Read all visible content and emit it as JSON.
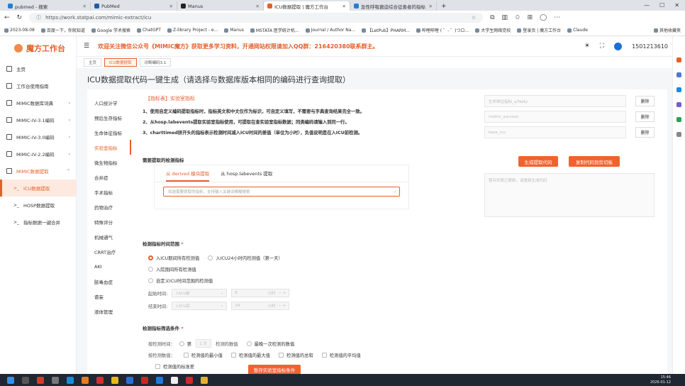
{
  "browser": {
    "tabs": [
      {
        "title": "pubmed - 搜索",
        "color": "#2b7cd3"
      },
      {
        "title": "PubMed",
        "color": "#1f5ca8"
      },
      {
        "title": "Manus",
        "color": "#222222"
      },
      {
        "title": "ICU数据提取 | 魔方工作台",
        "color": "#e4602b"
      },
      {
        "title": "急性呼吸窘迫综合征患者的指标",
        "color": "#2b7cd3"
      }
    ],
    "url": "https://work.statpai.com/mimic-extract/icu",
    "bookmarks": [
      "2023-08-08",
      "百度一下，你就知道",
      "Google 学术搜索",
      "ChatGPT",
      "Z-library Project - e...",
      "Manus",
      "MSTATA 医学统计机...",
      "Journal / Author Na...",
      "【LetPub】PHARM...",
      "哔哩哔哩 ( ゜- ゜)つロ...",
      "大学生网络党校",
      "登录页 | 魔方工作台",
      "Claude",
      "其他收藏夹"
    ]
  },
  "app": {
    "logo": "魔方工作台",
    "notice": "欢迎关注微信公众号《MIMIC魔方》获取更多学习资料，开通网站权限请加入QQ群：216420380联系群主。",
    "user": "1501213610",
    "nav": [
      {
        "label": "主页",
        "type": "item"
      },
      {
        "label": "工作台使用指南",
        "type": "item"
      },
      {
        "label": "MIMIC数据库词典",
        "type": "group"
      },
      {
        "label": "MIMIC-IV-3.1编码",
        "type": "group"
      },
      {
        "label": "MIMIC-IV-3.0编码",
        "type": "group"
      },
      {
        "label": "MIMIC-IV-2.2编码",
        "type": "group"
      },
      {
        "label": "MIMIC数据提取",
        "type": "group-open"
      },
      {
        "label": "ICU数据提取",
        "type": "active"
      },
      {
        "label": "HOSP数据提取",
        "type": "sub"
      },
      {
        "label": "指标数据一键合并",
        "type": "sub"
      }
    ],
    "breadcrumbs": [
      "主页",
      "ICU数据提取",
      "诊断编码3.1"
    ]
  },
  "page": {
    "title": "ICU数据提取代码一键生成（请选择与数据库版本相同的编码进行查询提取）",
    "subnav": [
      "人口统计学",
      "预后生存指标",
      "生命体征指标",
      "实验室指标",
      "微生物指标",
      "合并症",
      "手术指标",
      "药物治疗",
      "特殊评分",
      "机械通气",
      "CRRT治疗",
      "AKI",
      "脓毒血症",
      "谵妄",
      "液体管理"
    ],
    "subnav_active": "实验室指标",
    "tip": {
      "title": "【指标表】实验室指标",
      "lines": [
        "1、使用自定义编码提取指标时，指标英文和中文仅作为标识，可自定义填写，不需要与字典查询结果完全一致。",
        "2、从hosp.labevents提取实验室指标使用，可提取在查实验室指标数据；同类编码请输入到同一行。",
        "3、charttimed拼开头的指标表示检测时间减入ICU时间的差值（单位为小时），负值说明是在入ICU前检测。"
      ]
    },
    "section1": "需要提取的检测指标",
    "source_tabs": [
      "从 derived 模块提取",
      "从 hosp.labevents 提取"
    ],
    "select_placeholder": "如选需要提取的指标，支持输入关键词模糊搜索",
    "section2": "检测指标时间范围",
    "time_options": [
      "入ICU期间所有检测值",
      "入ICU24小时内检测值（第一天）",
      "入院期间所有检测值",
      "自定义ICU时间范围的检测值"
    ],
    "start_label": "起始时间:",
    "end_label": "结束时间:",
    "start_anchor": "入ICU前",
    "end_anchor": "入ICU后",
    "start_value": "6",
    "end_value": "24",
    "unit": "小时",
    "section3": "检测指标筛选条件",
    "filter_time_label": "按检测时间：",
    "filter_nth_prefix": "第",
    "filter_nth_value": "1 次",
    "filter_nth_suffix": "检测的数值",
    "filter_last": "最晚一次检测的数值",
    "filter_value_label": "按检测数值：",
    "filter_values": [
      "检测值的最小值",
      "检测值的最大值",
      "检测值的总和",
      "检测值的平均值",
      "检测值的标准差"
    ],
    "save_button": "暂存实验室指标条件",
    "right_fields": [
      "生命体征指标_a/Tality",
      "metric_survival",
      "base_icu"
    ],
    "delete_label": "删除",
    "generate_button": "生成提取代码",
    "copy_button": "复制代码到剪切板",
    "code_placeholder": "暂存列表已更新，请重新生成代码"
  },
  "taskbar": {
    "time": "15:46",
    "date": "2026-01-12",
    "lang": "英"
  }
}
